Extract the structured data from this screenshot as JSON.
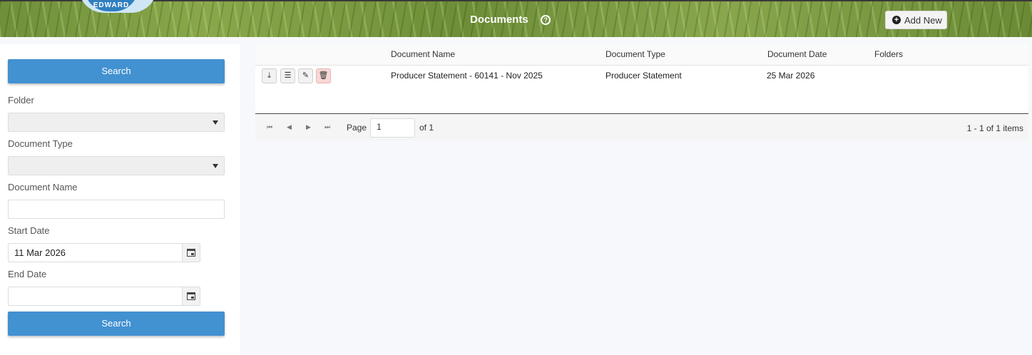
{
  "header": {
    "logo_text": "EDWARD",
    "title": "Documents",
    "help_icon": "question-circle-icon",
    "add_new_label": "Add New",
    "add_new_icon": "plus-circle-icon"
  },
  "sidebar": {
    "search_label_top": "Search",
    "folder_label": "Folder",
    "folder_value": "",
    "document_type_label": "Document Type",
    "document_type_value": "",
    "document_name_label": "Document Name",
    "document_name_value": "",
    "start_date_label": "Start Date",
    "start_date_value": "11 Mar 2026",
    "end_date_label": "End Date",
    "end_date_value": "",
    "search_label_bottom": "Search"
  },
  "grid": {
    "columns": [
      "Document Name",
      "Document Type",
      "Document Date",
      "Folders"
    ],
    "rows": [
      {
        "name": "Producer Statement - 60141 - Nov 2025",
        "type": "Producer Statement",
        "date": "25 Mar 2026",
        "folders": ""
      }
    ],
    "row_actions": [
      "download-icon",
      "list-icon",
      "pencil-icon",
      "trash-icon"
    ]
  },
  "pager": {
    "page_label": "Page",
    "page_value": "1",
    "of_label": "of 1",
    "info": "1 - 1 of 1 items"
  },
  "colors": {
    "primary_button": "#4291d1",
    "delete_button": "#f8d7d7"
  }
}
